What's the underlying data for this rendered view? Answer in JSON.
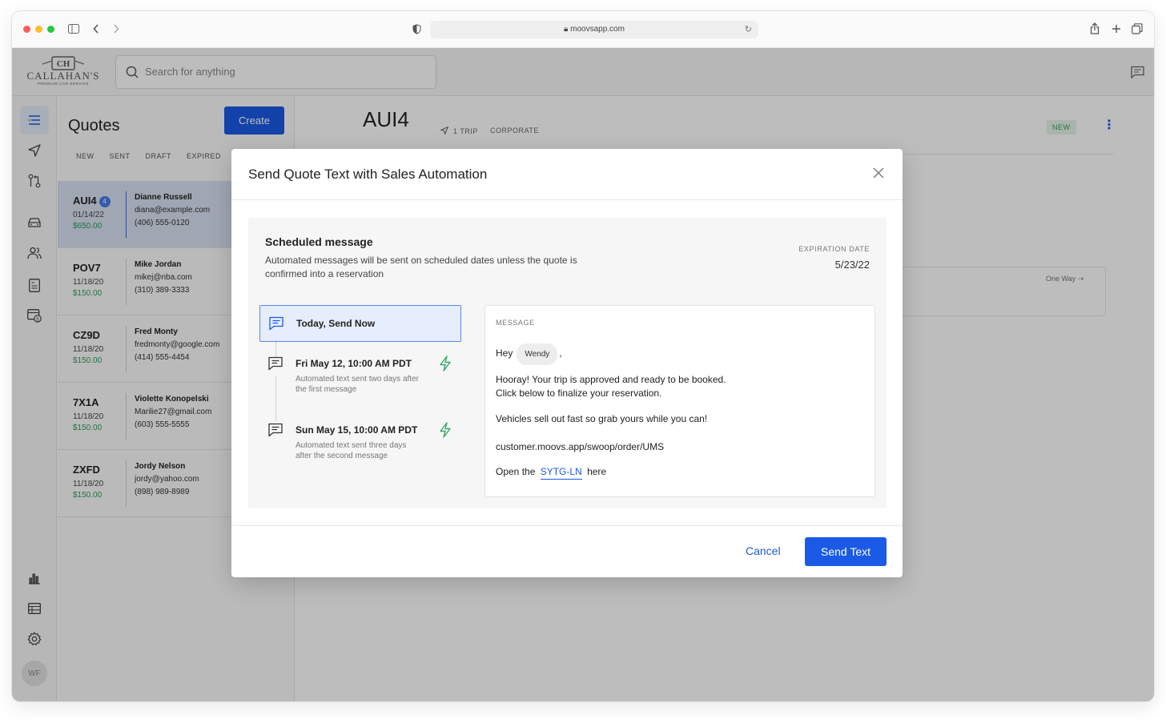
{
  "browser": {
    "url": "moovsapp.com"
  },
  "brand": {
    "name": "CALLAHAN'S",
    "tagline": "PREMIUM CAR SERVICE",
    "initials": "CH"
  },
  "search": {
    "placeholder": "Search for anything"
  },
  "user": {
    "initials": "WF"
  },
  "quotes": {
    "title": "Quotes",
    "create_label": "Create",
    "filters": [
      "NEW",
      "SENT",
      "DRAFT",
      "EXPIRED"
    ],
    "items": [
      {
        "code": "AUI4",
        "badge": "4",
        "date": "01/14/22",
        "price": "$650.00",
        "name": "Dianne Russell",
        "email": "diana@example.com",
        "phone": "(406) 555-0120"
      },
      {
        "code": "POV7",
        "badge": "",
        "date": "11/18/20",
        "price": "$150.00",
        "name": "Mike Jordan",
        "email": "mikej@nba.com",
        "phone": "(310) 389-3333"
      },
      {
        "code": "CZ9D",
        "badge": "",
        "date": "11/18/20",
        "price": "$150.00",
        "name": "Fred Monty",
        "email": "fredmonty@google.com",
        "phone": "(414) 555-4454"
      },
      {
        "code": "7X1A",
        "badge": "",
        "date": "11/18/20",
        "price": "$150.00",
        "name": "Violette Konopelski",
        "email": "Marilie27@gmail.com",
        "phone": "(603) 555-5555"
      },
      {
        "code": "ZXFD",
        "badge": "",
        "date": "11/18/20",
        "price": "$150.00",
        "name": "Jordy Nelson",
        "email": "jordy@yahoo.com",
        "phone": "(898) 989-8989"
      }
    ]
  },
  "detail": {
    "title": "AUI4",
    "trips": "1 TRIP",
    "type": "CORPORATE",
    "status": "NEW",
    "trip_type": "One Way"
  },
  "modal": {
    "title": "Send Quote Text with Sales Automation",
    "scheduled_title": "Scheduled message",
    "scheduled_desc": "Automated messages will be sent on scheduled dates unless the quote is confirmed into a reservation",
    "expiration_label": "EXPIRATION DATE",
    "expiration_value": "5/23/22",
    "steps": [
      {
        "title": "Today, Send Now",
        "desc": ""
      },
      {
        "title": "Fri May 12, 10:00 AM PDT",
        "desc": "Automated text sent two days after the first message"
      },
      {
        "title": "Sun May  15, 10:00 AM PDT",
        "desc": "Automated text sent three days after the second message"
      }
    ],
    "message": {
      "label": "MESSAGE",
      "greeting": "Hey",
      "name_chip": "Wendy",
      "comma": ",",
      "line1": "Hooray! Your trip is approved and ready to be booked.",
      "line2": "Click below to finalize your reservation.",
      "line3": "Vehicles sell out fast so grab yours while you can!",
      "link": "customer.moovs.app/swoop/order/UMS",
      "open_prefix": "Open the",
      "open_code": "SYTG-LN",
      "open_suffix": "here"
    },
    "cancel_label": "Cancel",
    "send_label": "Send Text"
  },
  "colors": {
    "primary": "#1a5ae6",
    "price_green": "#2f9a5a",
    "selected_row": "#d8e1f1",
    "bolt_green": "#35a86a"
  }
}
